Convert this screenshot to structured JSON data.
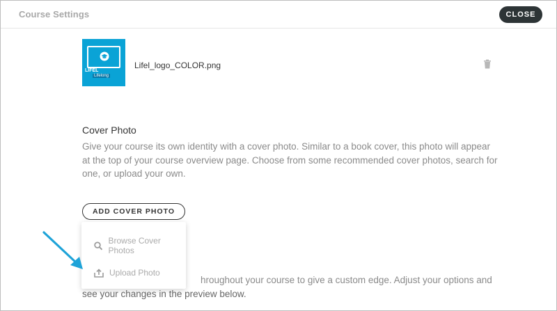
{
  "header": {
    "title": "Course Settings",
    "close_label": "CLOSE"
  },
  "logo": {
    "filename": "Lifel_logo_COLOR.png",
    "tile_text": "LIFEL",
    "tile_subtext": "Lifelong",
    "brand_color": "#0aa3d6"
  },
  "cover_photo": {
    "heading": "Cover Photo",
    "description": "Give your course its own identity with a cover photo. Similar to a book cover, this photo will appear at the top of your course overview page. Choose from some recommended cover photos, search for one, or upload your own.",
    "add_button_label": "ADD COVER PHOTO"
  },
  "dropdown": {
    "items": [
      {
        "label": "Browse Cover Photos",
        "icon": "search-icon"
      },
      {
        "label": "Upload Photo",
        "icon": "upload-icon"
      }
    ]
  },
  "next_section": {
    "line1": "hroughout your course to give a custom edge. Adjust your options and",
    "line2": "see your changes in the preview below."
  },
  "annotation": {
    "arrow_color": "#1ea3d8"
  }
}
